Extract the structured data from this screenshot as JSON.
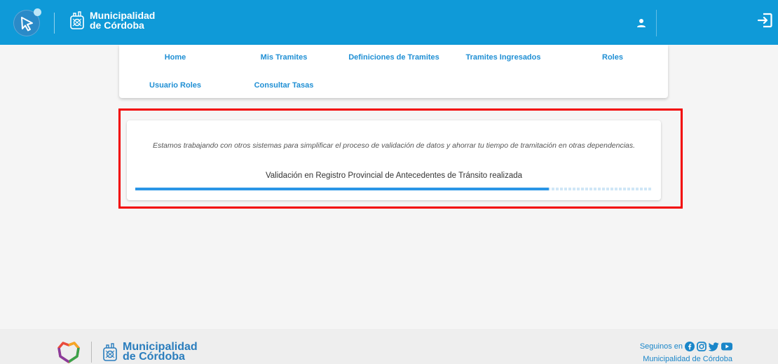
{
  "header": {
    "brand_label": "Municipalidad\nde Córdoba",
    "icons": [
      "app-cursor-icon",
      "municipal-crest-icon",
      "user-icon",
      "logout-icon"
    ]
  },
  "nav": {
    "items": [
      {
        "label": "Home"
      },
      {
        "label": "Mis Tramites"
      },
      {
        "label": "Definiciones de Tramites"
      },
      {
        "label": "Tramites Ingresados"
      },
      {
        "label": "Roles"
      },
      {
        "label": "Usuario Roles"
      },
      {
        "label": "Consultar Tasas"
      }
    ]
  },
  "validation": {
    "message": "Estamos trabajando con otros sistemas para simplificar el proceso de validación de datos y ahorrar tu tiempo de tramitación en otras dependencias.",
    "status": "Validación en Registro Provincial de Antecedentes de Tránsito realizada",
    "progress": 0.8
  },
  "footer": {
    "brand_label": "Municipalidad\nde Córdoba",
    "follow_label": "Seguinos en",
    "org_link": "Municipalidad de Córdoba",
    "social_icons": [
      "facebook-icon",
      "instagram-icon",
      "twitter-icon",
      "youtube-icon"
    ]
  },
  "colors": {
    "header_bg": "#0f9ad8",
    "link": "#1f8fd4",
    "progress": "#2a95e6",
    "highlight": "#f20000"
  }
}
